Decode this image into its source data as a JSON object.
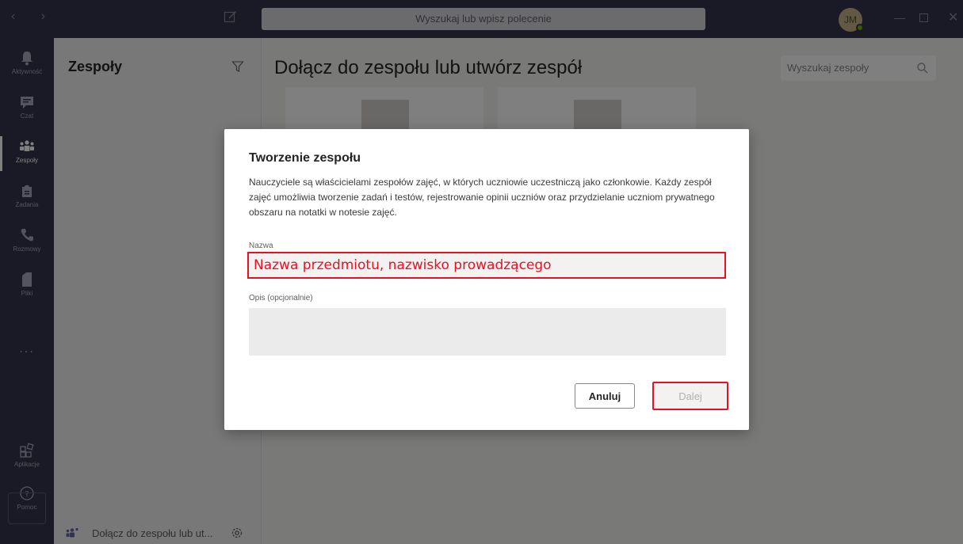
{
  "topbar": {
    "search_placeholder": "Wyszukaj lub wpisz polecenie",
    "avatar_initials": "JM"
  },
  "rail": {
    "items": [
      {
        "label": "Aktywność",
        "icon": "bell-icon"
      },
      {
        "label": "Czat",
        "icon": "chat-icon"
      },
      {
        "label": "Zespoły",
        "icon": "teams-icon",
        "active": true
      },
      {
        "label": "Zadania",
        "icon": "assignments-icon"
      },
      {
        "label": "Rozmowy",
        "icon": "phone-icon"
      },
      {
        "label": "Pliki",
        "icon": "file-icon"
      },
      {
        "label": "Aplikacje",
        "icon": "apps-icon"
      },
      {
        "label": "Pomoc",
        "icon": "help-icon"
      }
    ],
    "more": "..."
  },
  "panel": {
    "title": "Zespoły",
    "join_label": "Dołącz do zespołu lub ut..."
  },
  "main": {
    "title": "Dołącz do zespołu lub utwórz zespół",
    "team_search_placeholder": "Wyszukaj zespoły"
  },
  "dialog": {
    "title": "Tworzenie zespołu",
    "description": "Nauczyciele są właścicielami zespołów zajęć, w których uczniowie uczestniczą jako członkowie. Każdy zespół zajęć umożliwia tworzenie zadań i testów, rejestrowanie opinii uczniów oraz przydzielanie uczniom prywatnego obszaru na notatki w notesie zajęć.",
    "name_label": "Nazwa",
    "name_value": "Nazwa przedmiotu, nazwisko prowadzącego",
    "desc_label": "Opis (opcjonalnie)",
    "cancel_label": "Anuluj",
    "next_label": "Dalej"
  },
  "colors": {
    "rail_bg": "#33344a",
    "highlight": "#e81123"
  }
}
